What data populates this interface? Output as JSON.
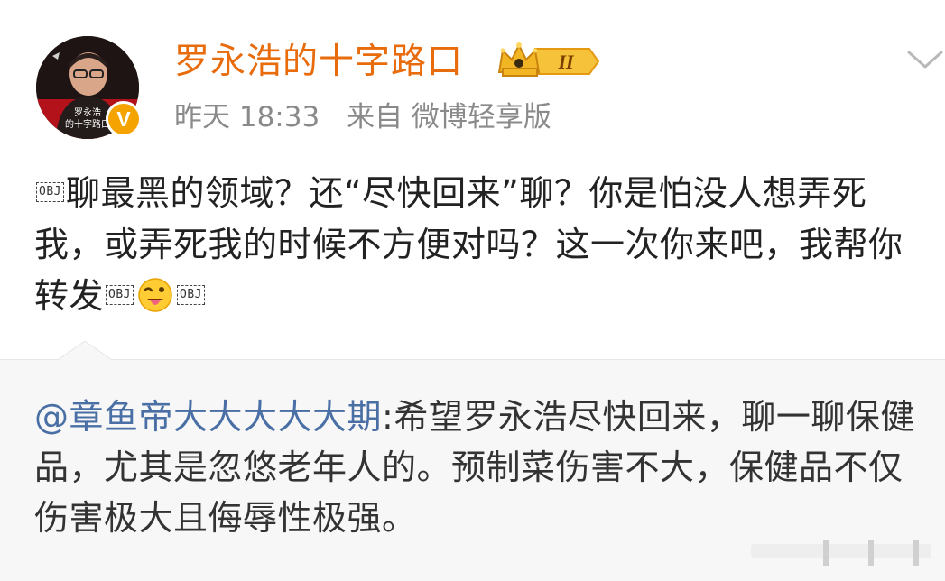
{
  "user": {
    "name": "罗永浩的十字路口",
    "avatar_caption_line1": "罗永浩",
    "avatar_caption_line2": "的十字路口",
    "verified_symbol": "V",
    "vip_level": "II"
  },
  "meta": {
    "time": "昨天 18:33",
    "source": "来自 微博轻享版"
  },
  "post": {
    "obj_label": "OBJ",
    "text_part1": "聊最黑的领域？还“尽快回来”聊？你是怕没人想弄死我，或弄死我的时候不方便对吗？这一次你来吧，我帮你转发"
  },
  "repost": {
    "mention": "@章鱼帝大大大大大期",
    "text": ":希望罗永浩尽快回来，聊一聊保健品，尤其是忽悠老年人的。预制菜伤害不大，保健品不仅伤害极大且侮辱性极强。"
  },
  "colors": {
    "username": "#e86b0c",
    "mention": "#4a6fa5",
    "verified": "#f5a300",
    "repost_bg": "#f7f7f7"
  },
  "icons": {
    "expand": "chevron-down-icon",
    "verified": "verified-badge-icon",
    "vip": "vip-crown-icon",
    "emoji": "tongue-wink-emoji"
  }
}
